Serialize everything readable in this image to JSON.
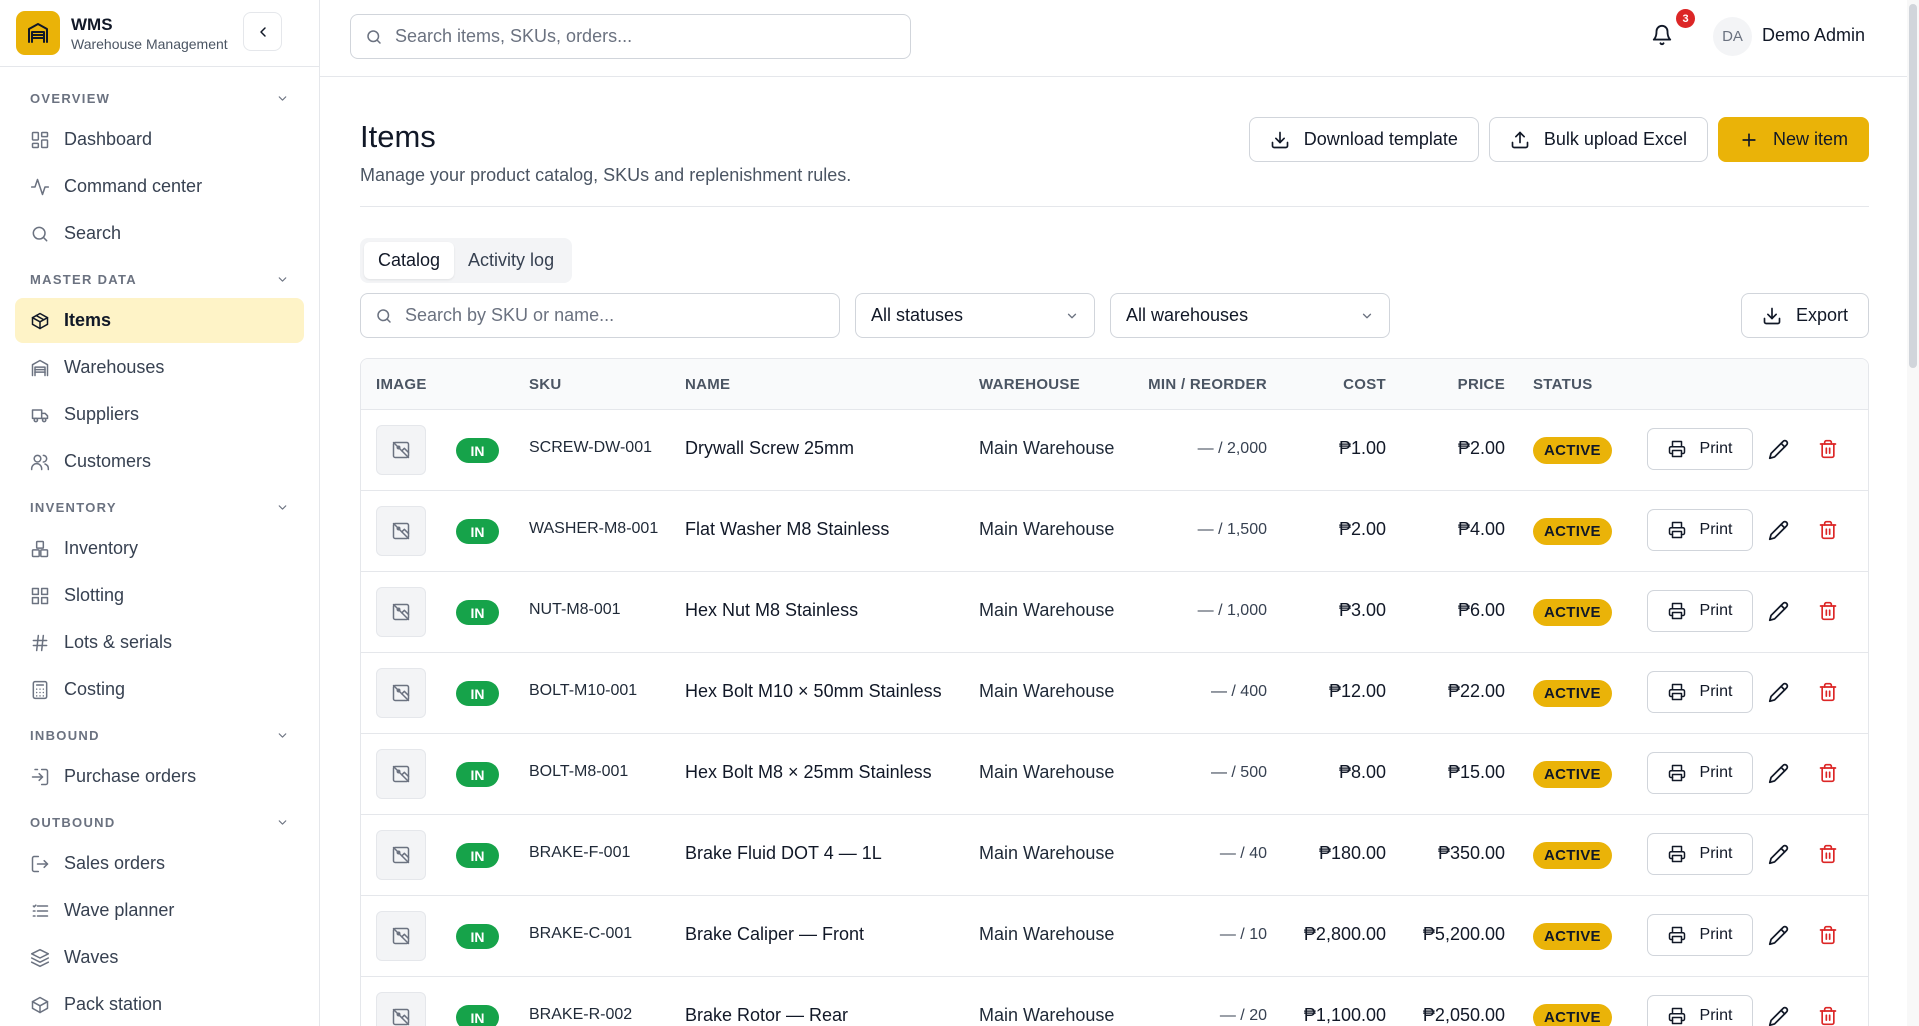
{
  "brand": {
    "title": "WMS",
    "subtitle": "Warehouse Management"
  },
  "sidebar": {
    "sections": [
      {
        "label": "OVERVIEW",
        "items": [
          {
            "label": "Dashboard",
            "icon": "dashboard-icon"
          },
          {
            "label": "Command center",
            "icon": "activity-icon"
          },
          {
            "label": "Search",
            "icon": "search-icon"
          }
        ]
      },
      {
        "label": "MASTER DATA",
        "items": [
          {
            "label": "Items",
            "icon": "package-icon",
            "active": true
          },
          {
            "label": "Warehouses",
            "icon": "warehouse-icon"
          },
          {
            "label": "Suppliers",
            "icon": "truck-icon"
          },
          {
            "label": "Customers",
            "icon": "users-icon"
          }
        ]
      },
      {
        "label": "INVENTORY",
        "items": [
          {
            "label": "Inventory",
            "icon": "boxes-icon"
          },
          {
            "label": "Slotting",
            "icon": "grid-icon"
          },
          {
            "label": "Lots & serials",
            "icon": "hash-icon"
          },
          {
            "label": "Costing",
            "icon": "calculator-icon"
          }
        ]
      },
      {
        "label": "INBOUND",
        "items": [
          {
            "label": "Purchase orders",
            "icon": "inbound-icon"
          }
        ]
      },
      {
        "label": "OUTBOUND",
        "items": [
          {
            "label": "Sales orders",
            "icon": "outbound-icon"
          },
          {
            "label": "Wave planner",
            "icon": "list-icon"
          },
          {
            "label": "Waves",
            "icon": "layers-icon"
          },
          {
            "label": "Pack station",
            "icon": "pack-icon"
          }
        ]
      }
    ]
  },
  "topbar": {
    "search_placeholder": "Search items, SKUs, orders...",
    "notifications_count": "3",
    "avatar_initials": "DA",
    "user_name": "Demo Admin"
  },
  "page": {
    "title": "Items",
    "subtitle": "Manage your product catalog, SKUs and replenishment rules.",
    "download_template_label": "Download template",
    "bulk_upload_label": "Bulk upload Excel",
    "new_item_label": "New item"
  },
  "tabs": [
    {
      "label": "Catalog",
      "active": true
    },
    {
      "label": "Activity log",
      "active": false
    }
  ],
  "filters": {
    "search_placeholder": "Search by SKU or name...",
    "status_selected": "All statuses",
    "warehouse_selected": "All warehouses",
    "export_label": "Export"
  },
  "table": {
    "headers": {
      "image": "IMAGE",
      "sku": "SKU",
      "name": "NAME",
      "warehouse": "WAREHOUSE",
      "min_reorder": "MIN / REORDER",
      "cost": "COST",
      "price": "PRICE",
      "status": "STATUS"
    },
    "print_label": "Print",
    "rows": [
      {
        "type": "IN",
        "sku": "SCREW-DW-001",
        "name": "Drywall Screw 25mm",
        "warehouse": "Main Warehouse",
        "min_reorder": "— / 2,000",
        "cost": "₱1.00",
        "price": "₱2.00",
        "status": "ACTIVE"
      },
      {
        "type": "IN",
        "sku": "WASHER-M8-001",
        "name": "Flat Washer M8 Stainless",
        "warehouse": "Main Warehouse",
        "min_reorder": "— / 1,500",
        "cost": "₱2.00",
        "price": "₱4.00",
        "status": "ACTIVE"
      },
      {
        "type": "IN",
        "sku": "NUT-M8-001",
        "name": "Hex Nut M8 Stainless",
        "warehouse": "Main Warehouse",
        "min_reorder": "— / 1,000",
        "cost": "₱3.00",
        "price": "₱6.00",
        "status": "ACTIVE"
      },
      {
        "type": "IN",
        "sku": "BOLT-M10-001",
        "name": "Hex Bolt M10 × 50mm Stainless",
        "warehouse": "Main Warehouse",
        "min_reorder": "— / 400",
        "cost": "₱12.00",
        "price": "₱22.00",
        "status": "ACTIVE"
      },
      {
        "type": "IN",
        "sku": "BOLT-M8-001",
        "name": "Hex Bolt M8 × 25mm Stainless",
        "warehouse": "Main Warehouse",
        "min_reorder": "— / 500",
        "cost": "₱8.00",
        "price": "₱15.00",
        "status": "ACTIVE"
      },
      {
        "type": "IN",
        "sku": "BRAKE-F-001",
        "name": "Brake Fluid DOT 4 — 1L",
        "warehouse": "Main Warehouse",
        "min_reorder": "— / 40",
        "cost": "₱180.00",
        "price": "₱350.00",
        "status": "ACTIVE"
      },
      {
        "type": "IN",
        "sku": "BRAKE-C-001",
        "name": "Brake Caliper — Front",
        "warehouse": "Main Warehouse",
        "min_reorder": "— / 10",
        "cost": "₱2,800.00",
        "price": "₱5,200.00",
        "status": "ACTIVE"
      },
      {
        "type": "IN",
        "sku": "BRAKE-R-002",
        "name": "Brake Rotor — Rear",
        "warehouse": "Main Warehouse",
        "min_reorder": "— / 20",
        "cost": "₱1,100.00",
        "price": "₱2,050.00",
        "status": "ACTIVE"
      }
    ]
  },
  "colors": {
    "accent": "#eab308",
    "accent_light": "#fef3c7",
    "in_badge": "#16a34a",
    "danger": "#dc2626"
  }
}
